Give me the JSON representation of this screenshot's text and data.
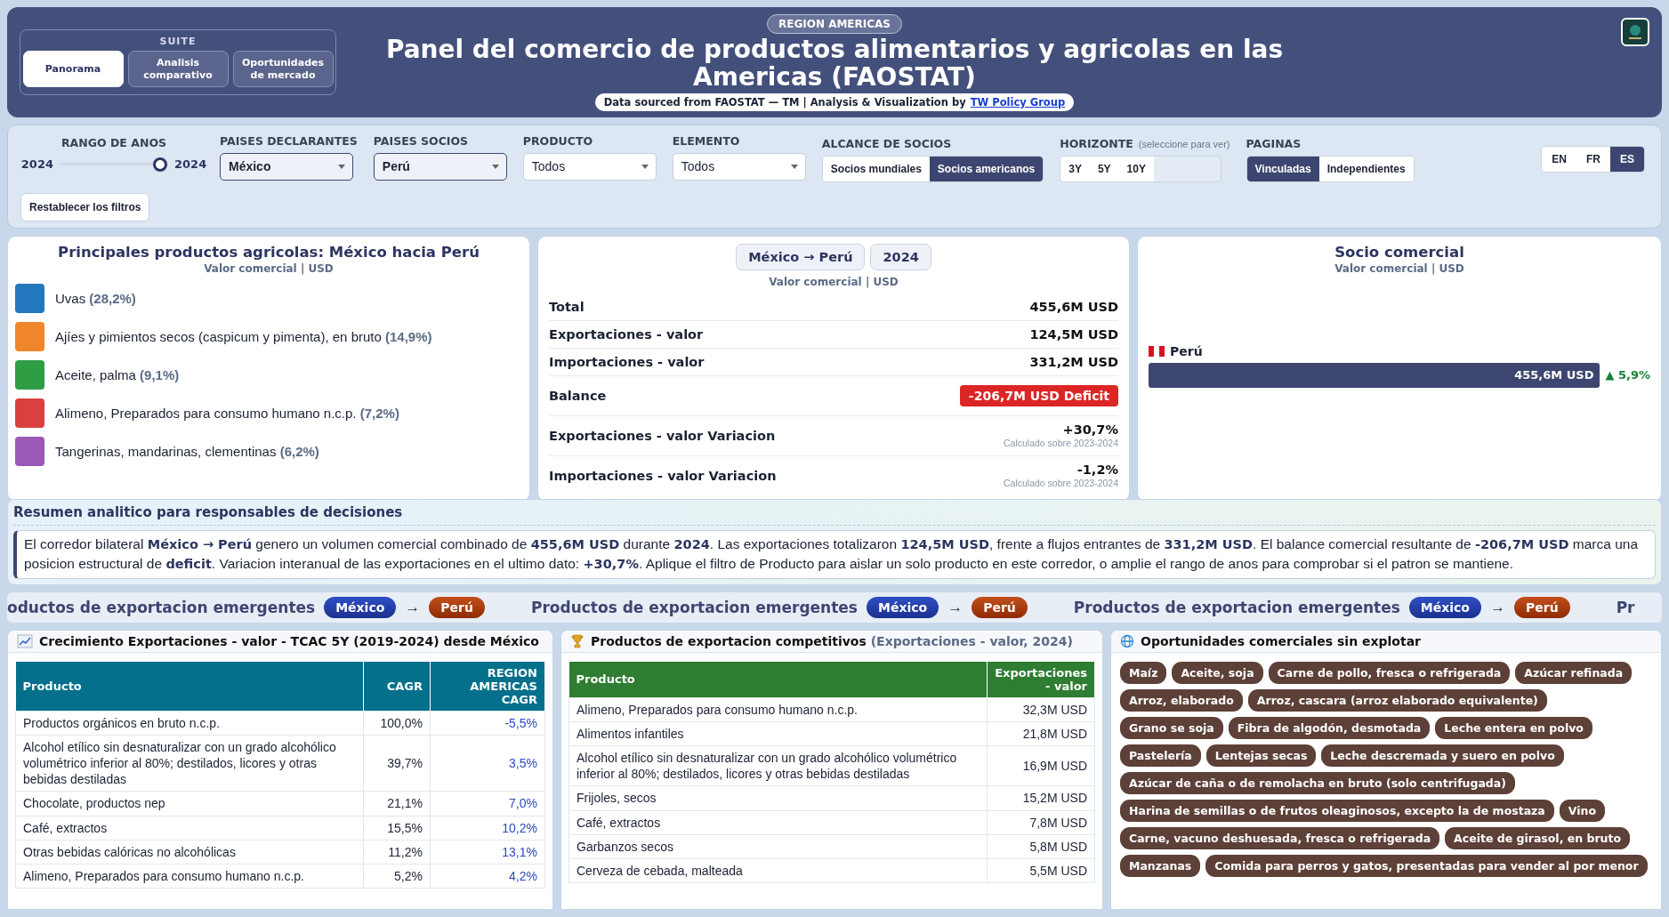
{
  "header": {
    "suite": {
      "label": "SUITE",
      "tabs": [
        {
          "label": "Panorama",
          "selected": true
        },
        {
          "label": "Analisis comparativo",
          "selected": false
        },
        {
          "label": "Oportunidades de mercado",
          "selected": false
        }
      ]
    },
    "badge": "REGION AMERICAS",
    "title": "Panel del comercio de productos alimentarios y agricolas en las Americas (FAOSTAT)",
    "source": {
      "text": "Data sourced from FAOSTAT — TM | Analysis & Visualization by",
      "link": "TW Policy Group"
    }
  },
  "filters": {
    "year_range": {
      "label": "RANGO DE ANOS",
      "from": "2024",
      "to": "2024",
      "level": 1
    },
    "dropdowns": [
      {
        "label": "PAISES DECLARANTES",
        "value": "México",
        "active": true
      },
      {
        "label": "PAISES SOCIOS",
        "value": "Perú",
        "active": true
      },
      {
        "label": "PRODUCTO",
        "value": "Todos",
        "active": false
      },
      {
        "label": "ELEMENTO",
        "value": "Todos",
        "active": false
      }
    ],
    "partner_scope": {
      "label": "ALCANCE DE SOCIOS",
      "options": [
        {
          "label": "Socios mundiales",
          "selected": false
        },
        {
          "label": "Socios americanos",
          "selected": true
        }
      ]
    },
    "horizon": {
      "label": "HORIZONTE",
      "hint": "(seleccione para ver)",
      "options": [
        {
          "label": "3Y",
          "selected": false
        },
        {
          "label": "5Y",
          "selected": false
        },
        {
          "label": "10Y",
          "selected": false
        }
      ]
    },
    "pages": {
      "label": "PAGINAS",
      "options": [
        {
          "label": "Vinculadas",
          "selected": true
        },
        {
          "label": "Independientes",
          "selected": false
        }
      ]
    },
    "languages": [
      {
        "label": "EN",
        "selected": false
      },
      {
        "label": "FR",
        "selected": false
      },
      {
        "label": "ES",
        "selected": true
      }
    ],
    "reset_button": "Restablecer los filtros"
  },
  "top_products": {
    "title": "Principales productos agricolas: México hacia Perú",
    "subtitle": "Valor comercial | USD",
    "items": [
      {
        "name": "Uvas",
        "share": "(28,2%)",
        "color": "#2377bd"
      },
      {
        "name": "Ajíes y pimientos secos (caspicum y pimenta), en bruto",
        "share": "(14,9%)",
        "color": "#f0862c"
      },
      {
        "name": "Aceite, palma",
        "share": "(9,1%)",
        "color": "#2e9d44"
      },
      {
        "name": "Alimeno, Preparados para consumo humano n.c.p.",
        "share": "(7,2%)",
        "color": "#d94040"
      },
      {
        "name": "Tangerinas, mandarinas, clementinas",
        "share": "(6,2%)",
        "color": "#9b59b6"
      }
    ]
  },
  "trade_summary": {
    "chips": [
      "México → Perú",
      "2024"
    ],
    "subtitle": "Valor comercial | USD",
    "rows": [
      {
        "kind": "plain",
        "label": "Total",
        "value": "455,6M USD"
      },
      {
        "kind": "plain",
        "label": "Exportaciones - valor",
        "value": "124,5M USD"
      },
      {
        "kind": "plain",
        "label": "Importaciones - valor",
        "value": "331,2M USD"
      },
      {
        "kind": "badge",
        "label": "Balance",
        "value": "-206,7M USD Deficit"
      },
      {
        "kind": "change",
        "label": "Exportaciones - valor Variacion",
        "value": "+30,7%",
        "note": "Calculado sobre 2023-2024"
      },
      {
        "kind": "change",
        "label": "Importaciones - valor Variacion",
        "value": "-1,2%",
        "note": "Calculado sobre 2023-2024"
      }
    ]
  },
  "partner": {
    "title": "Socio comercial",
    "subtitle": "Valor comercial | USD",
    "partners": [
      {
        "name": "Perú",
        "value": "455,6M USD",
        "change": "▲ 5,9%"
      }
    ]
  },
  "analysis": {
    "title": "Resumen analitico para responsables de decisiones",
    "text": "El corredor bilateral **México → Perú** genero un volumen comercial combinado de **455,6M USD** durante **2024**. Las exportaciones totalizaron **124,5M USD**, frente a flujos entrantes de **331,2M USD**. El balance comercial resultante de **-206,7M USD** marca una posicion estructural de **deficit**. Variacion interanual de las exportaciones en el ultimo dato: **+30,7%**. Aplique el filtro de Producto para aislar un solo producto en este corredor, o amplie el rango de anos para comprobar si el patron se mantiene."
  },
  "ticker": [
    {
      "title": "oductos de exportacion emergentes",
      "from": "México",
      "arrow": "→",
      "to": "Perú"
    },
    {
      "title": "Productos de exportacion emergentes",
      "from": "México",
      "arrow": "→",
      "to": "Perú"
    },
    {
      "title": "Productos de exportacion emergentes",
      "from": "México",
      "arrow": "→",
      "to": "Perú"
    },
    {
      "title": "Pr"
    }
  ],
  "growth": {
    "title": "Crecimiento Exportaciones - valor - TCAC 5Y (2019-2024) desde México",
    "columns": [
      "Producto",
      "CAGR",
      "REGION AMERICAS CAGR"
    ],
    "rows": [
      [
        "Productos orgánicos en bruto n.c.p.",
        "100,0%",
        "-5,5%"
      ],
      [
        "Alcohol etílico sin desnaturalizar con un grado alcohólico volumétrico inferior al 80%; destilados, licores y otras bebidas destiladas",
        "39,7%",
        "3,5%"
      ],
      [
        "Chocolate, productos nep",
        "21,1%",
        "7,0%"
      ],
      [
        "Café, extractos",
        "15,5%",
        "10,2%"
      ],
      [
        "Otras bebidas calóricas no alcohólicas",
        "11,2%",
        "13,1%"
      ],
      [
        "Alimeno, Preparados para consumo humano n.c.p.",
        "5,2%",
        "4,2%"
      ]
    ]
  },
  "competitive": {
    "title": "Productos de exportacion competitivos",
    "note": "(Exportaciones - valor, 2024)",
    "columns": [
      "Producto",
      "Exportaciones - valor"
    ],
    "rows": [
      [
        "Alimeno, Preparados para consumo humano n.c.p.",
        "32,3M USD"
      ],
      [
        "Alimentos infantiles",
        "21,8M USD"
      ],
      [
        "Alcohol etílico sin desnaturalizar con un grado alcohólico volumétrico inferior al 80%; destilados, licores y otras bebidas destiladas",
        "16,9M USD"
      ],
      [
        "Frijoles, secos",
        "15,2M USD"
      ],
      [
        "Café, extractos",
        "7,8M USD"
      ],
      [
        "Garbanzos secos",
        "5,8M USD"
      ],
      [
        "Cerveza de cebada, malteada",
        "5,5M USD"
      ]
    ]
  },
  "opportunities": {
    "title": "Oportunidades comerciales sin explotar",
    "items": [
      "Maíz",
      "Aceite, soja",
      "Carne de pollo, fresca o refrigerada",
      "Azúcar refinada",
      "Arroz, elaborado",
      "Arroz, cascara (arroz elaborado equivalente)",
      "Grano se soja",
      "Fibra de algodón, desmotada",
      "Leche entera en polvo",
      "Pastelería",
      "Lentejas secas",
      "Leche descremada y suero en polvo",
      "Azúcar de caña o de remolacha en bruto (solo centrifugada)",
      "Harina de semillas o de frutos oleaginosos, excepto la de mostaza",
      "Vino",
      "Carne, vacuno deshuesada, fresca o refrigerada",
      "Aceite de girasol, en bruto",
      "Manzanas",
      "Comida para perros y gatos, presentadas para vender al por menor"
    ]
  }
}
